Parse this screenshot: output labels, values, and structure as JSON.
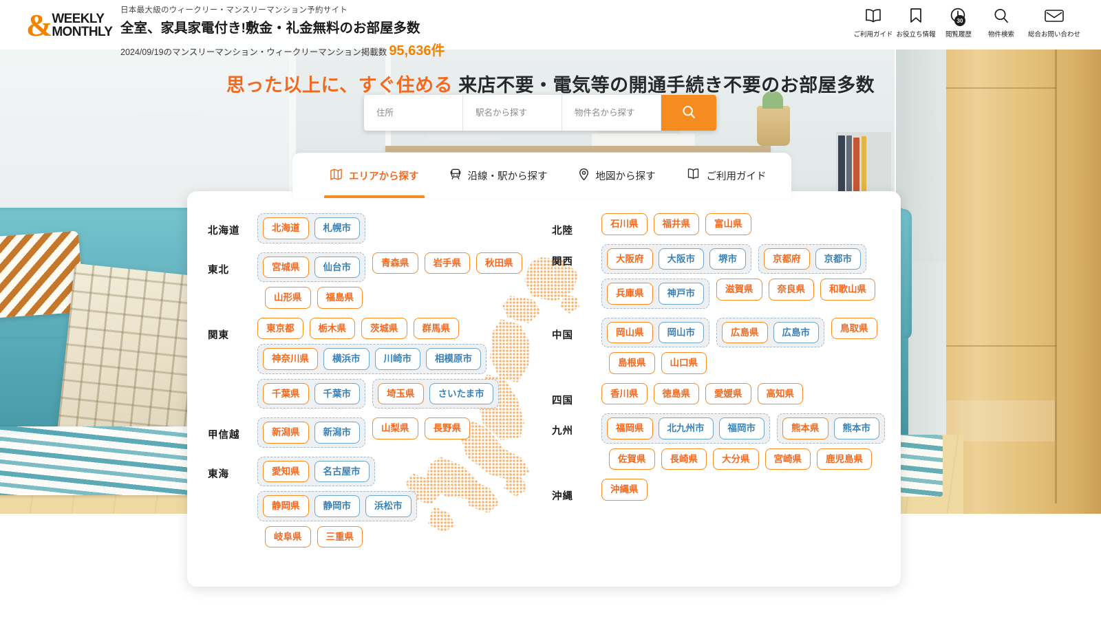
{
  "header": {
    "logo": {
      "amp": "&",
      "line1": "WEEKLY",
      "line2": "MONTHLY"
    },
    "tagline": "日本最大級のウィークリー・マンスリーマンション予約サイト",
    "headline": "全室、家具家電付き!敷金・礼金無料のお部屋多数",
    "stats_prefix": "2024/09/19のマンスリーマンション・ウィークリーマンション掲載数",
    "stats_count": "95,636件",
    "nav": [
      {
        "label": "ご利用ガイド",
        "icon": "book-icon"
      },
      {
        "label": "お役立ち情報",
        "icon": "bookmark-icon"
      },
      {
        "label": "閲覧履歴",
        "icon": "clock-icon",
        "badge": "30"
      },
      {
        "label": "物件検索",
        "icon": "search-icon"
      },
      {
        "label": "総合お問い合わせ",
        "icon": "envelope-icon"
      }
    ]
  },
  "hero": {
    "headline_orange": "思った以上に、すぐ住める",
    "headline_black": "来店不要・電気等の開通手続き不要のお部屋多数",
    "search": {
      "address_placeholder": "住所",
      "station_placeholder": "駅名から探す",
      "property_placeholder": "物件名から探す",
      "address_value": "",
      "station_value": "",
      "property_value": "",
      "button_icon": "search-icon"
    }
  },
  "tabs": [
    {
      "label": "エリアから探す",
      "icon": "map-fold-icon",
      "active": true
    },
    {
      "label": "沿線・駅から探す",
      "icon": "train-icon",
      "active": false
    },
    {
      "label": "地図から探す",
      "icon": "map-pin-icon",
      "active": false
    },
    {
      "label": "ご利用ガイド",
      "icon": "book-icon",
      "active": false
    }
  ],
  "area_panel": {
    "left_column": [
      {
        "region": "北海道",
        "items": [
          {
            "type": "group",
            "chips": [
              {
                "label": "北海道",
                "kind": "pref"
              },
              {
                "label": "札幌市",
                "kind": "city"
              }
            ]
          }
        ]
      },
      {
        "region": "東北",
        "items": [
          {
            "type": "group",
            "chips": [
              {
                "label": "宮城県",
                "kind": "pref"
              },
              {
                "label": "仙台市",
                "kind": "city"
              }
            ]
          },
          {
            "type": "chip",
            "label": "青森県",
            "kind": "pref"
          },
          {
            "type": "chip",
            "label": "岩手県",
            "kind": "pref"
          },
          {
            "type": "chip",
            "label": "秋田県",
            "kind": "pref"
          },
          {
            "type": "break"
          },
          {
            "type": "chip",
            "label": "山形県",
            "kind": "pref",
            "indent": true
          },
          {
            "type": "chip",
            "label": "福島県",
            "kind": "pref"
          }
        ]
      },
      {
        "region": "関東",
        "items": [
          {
            "type": "chip",
            "label": "東京都",
            "kind": "pref"
          },
          {
            "type": "chip",
            "label": "栃木県",
            "kind": "pref"
          },
          {
            "type": "chip",
            "label": "茨城県",
            "kind": "pref"
          },
          {
            "type": "chip",
            "label": "群馬県",
            "kind": "pref"
          },
          {
            "type": "break"
          },
          {
            "type": "group",
            "chips": [
              {
                "label": "神奈川県",
                "kind": "pref"
              },
              {
                "label": "横浜市",
                "kind": "city"
              },
              {
                "label": "川崎市",
                "kind": "city"
              },
              {
                "label": "相模原市",
                "kind": "city"
              }
            ]
          },
          {
            "type": "break"
          },
          {
            "type": "group",
            "chips": [
              {
                "label": "千葉県",
                "kind": "pref"
              },
              {
                "label": "千葉市",
                "kind": "city"
              }
            ]
          },
          {
            "type": "group",
            "chips": [
              {
                "label": "埼玉県",
                "kind": "pref"
              },
              {
                "label": "さいたま市",
                "kind": "city"
              }
            ]
          }
        ]
      },
      {
        "region": "甲信越",
        "items": [
          {
            "type": "group",
            "chips": [
              {
                "label": "新潟県",
                "kind": "pref"
              },
              {
                "label": "新潟市",
                "kind": "city"
              }
            ]
          },
          {
            "type": "chip",
            "label": "山梨県",
            "kind": "pref"
          },
          {
            "type": "chip",
            "label": "長野県",
            "kind": "pref"
          }
        ]
      },
      {
        "region": "東海",
        "items": [
          {
            "type": "group",
            "chips": [
              {
                "label": "愛知県",
                "kind": "pref"
              },
              {
                "label": "名古屋市",
                "kind": "city"
              }
            ]
          },
          {
            "type": "group",
            "chips": [
              {
                "label": "静岡県",
                "kind": "pref"
              },
              {
                "label": "静岡市",
                "kind": "city"
              },
              {
                "label": "浜松市",
                "kind": "city"
              }
            ]
          },
          {
            "type": "break"
          },
          {
            "type": "chip",
            "label": "岐阜県",
            "kind": "pref",
            "indent": true
          },
          {
            "type": "chip",
            "label": "三重県",
            "kind": "pref"
          }
        ]
      }
    ],
    "right_column": [
      {
        "region": "北陸",
        "items": [
          {
            "type": "chip",
            "label": "石川県",
            "kind": "pref"
          },
          {
            "type": "chip",
            "label": "福井県",
            "kind": "pref"
          },
          {
            "type": "chip",
            "label": "富山県",
            "kind": "pref"
          }
        ]
      },
      {
        "region": "関西",
        "items": [
          {
            "type": "group",
            "chips": [
              {
                "label": "大阪府",
                "kind": "pref"
              },
              {
                "label": "大阪市",
                "kind": "city"
              },
              {
                "label": "堺市",
                "kind": "city"
              }
            ]
          },
          {
            "type": "group",
            "chips": [
              {
                "label": "京都府",
                "kind": "pref"
              },
              {
                "label": "京都市",
                "kind": "city"
              }
            ]
          },
          {
            "type": "break"
          },
          {
            "type": "group",
            "chips": [
              {
                "label": "兵庫県",
                "kind": "pref"
              },
              {
                "label": "神戸市",
                "kind": "city"
              }
            ]
          },
          {
            "type": "chip",
            "label": "滋賀県",
            "kind": "pref"
          },
          {
            "type": "chip",
            "label": "奈良県",
            "kind": "pref"
          },
          {
            "type": "chip",
            "label": "和歌山県",
            "kind": "pref"
          }
        ]
      },
      {
        "region": "中国",
        "items": [
          {
            "type": "group",
            "chips": [
              {
                "label": "岡山県",
                "kind": "pref"
              },
              {
                "label": "岡山市",
                "kind": "city"
              }
            ]
          },
          {
            "type": "group",
            "chips": [
              {
                "label": "広島県",
                "kind": "pref"
              },
              {
                "label": "広島市",
                "kind": "city"
              }
            ]
          },
          {
            "type": "chip",
            "label": "鳥取県",
            "kind": "pref"
          },
          {
            "type": "break"
          },
          {
            "type": "chip",
            "label": "島根県",
            "kind": "pref",
            "indent": true
          },
          {
            "type": "chip",
            "label": "山口県",
            "kind": "pref"
          }
        ]
      },
      {
        "region": "四国",
        "items": [
          {
            "type": "chip",
            "label": "香川県",
            "kind": "pref"
          },
          {
            "type": "chip",
            "label": "徳島県",
            "kind": "pref"
          },
          {
            "type": "chip",
            "label": "愛媛県",
            "kind": "pref"
          },
          {
            "type": "chip",
            "label": "高知県",
            "kind": "pref"
          }
        ]
      },
      {
        "region": "九州",
        "items": [
          {
            "type": "group",
            "chips": [
              {
                "label": "福岡県",
                "kind": "pref"
              },
              {
                "label": "北九州市",
                "kind": "city"
              },
              {
                "label": "福岡市",
                "kind": "city"
              }
            ]
          },
          {
            "type": "group",
            "chips": [
              {
                "label": "熊本県",
                "kind": "pref"
              },
              {
                "label": "熊本市",
                "kind": "city"
              }
            ]
          },
          {
            "type": "break"
          },
          {
            "type": "chip",
            "label": "佐賀県",
            "kind": "pref",
            "indent": true
          },
          {
            "type": "chip",
            "label": "長崎県",
            "kind": "pref"
          },
          {
            "type": "chip",
            "label": "大分県",
            "kind": "pref"
          },
          {
            "type": "chip",
            "label": "宮崎県",
            "kind": "pref"
          },
          {
            "type": "chip",
            "label": "鹿児島県",
            "kind": "pref"
          }
        ]
      },
      {
        "region": "沖縄",
        "items": [
          {
            "type": "chip",
            "label": "沖縄県",
            "kind": "pref"
          }
        ]
      }
    ]
  },
  "colors": {
    "brand_orange": "#F68B1F",
    "text_orange": "#F26A20",
    "city_blue": "#3b82b6",
    "group_border": "#9fb9d4",
    "group_bg": "#eef0f1"
  }
}
